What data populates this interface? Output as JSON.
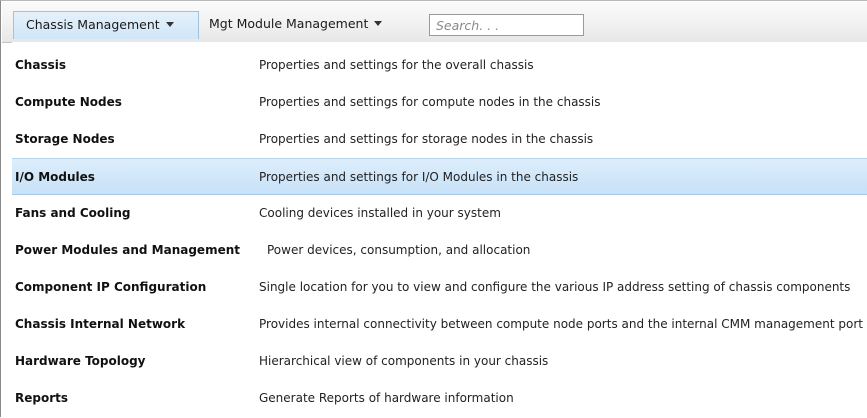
{
  "menubar": {
    "chassis_menu_label": "Chassis Management",
    "mgt_menu_label": "Mgt Module Management",
    "search_placeholder": "Search. . ."
  },
  "dropdown": {
    "items": [
      {
        "title": "Chassis",
        "description": "Properties and settings for the overall chassis"
      },
      {
        "title": "Compute Nodes",
        "description": "Properties and settings for compute nodes in the chassis"
      },
      {
        "title": "Storage Nodes",
        "description": "Properties and settings for storage nodes in the chassis"
      },
      {
        "title": "I/O Modules",
        "description": "Properties and settings for I/O Modules in the chassis"
      },
      {
        "title": "Fans and Cooling",
        "description": "Cooling devices installed in your system"
      },
      {
        "title": "Power Modules and Management",
        "description": "Power devices, consumption, and allocation"
      },
      {
        "title": "Component IP Configuration",
        "description": "Single location for you to view and configure the various IP address setting of chassis components"
      },
      {
        "title": "Chassis Internal Network",
        "description": "Provides internal connectivity between compute node ports and the internal CMM management port"
      },
      {
        "title": "Hardware Topology",
        "description": "Hierarchical view of components in your chassis"
      },
      {
        "title": "Reports",
        "description": "Generate Reports of hardware information"
      }
    ],
    "highlighted_item": "I/O Modules"
  },
  "colors": {
    "highlight": "#c7e1f7",
    "active_menu": "#d1e6f7",
    "menubar": "#f1f1f1"
  }
}
